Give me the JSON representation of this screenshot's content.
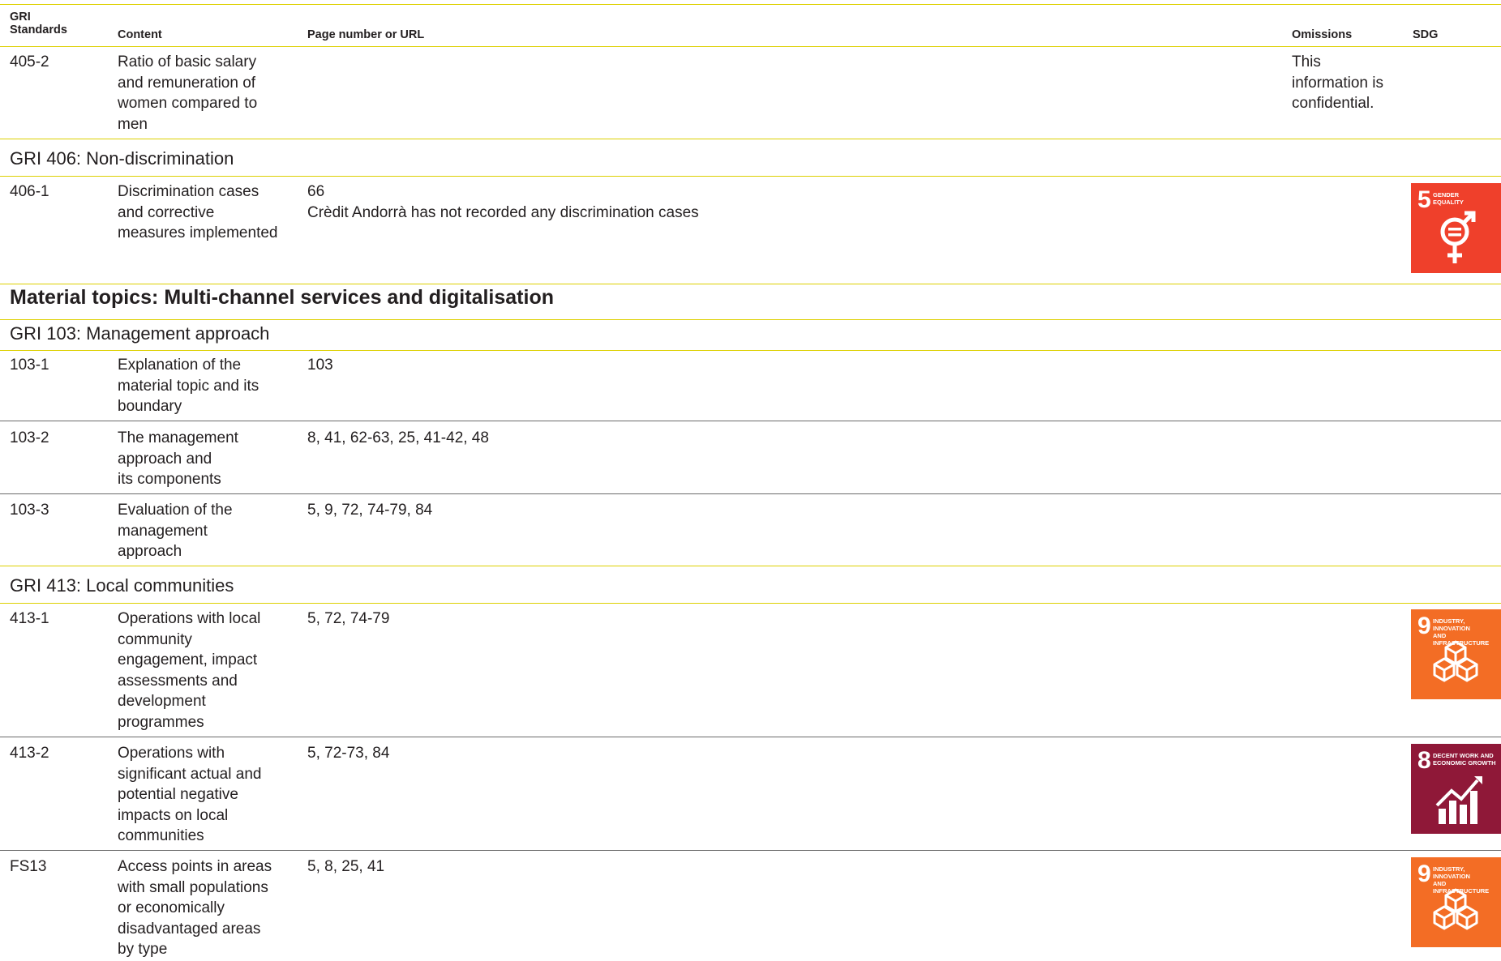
{
  "header": {
    "col_standards": "GRI\nStandards",
    "col_content": "Content",
    "col_page": "Page number or URL",
    "col_omissions": "Omissions",
    "col_sdg": "SDG"
  },
  "rows": [
    {
      "code": "405-2",
      "content": "Ratio of basic salary\nand remuneration of\nwomen compared to\nmen",
      "page": "",
      "omission": "This\ninformation is\nconfidential."
    },
    {
      "code": "406-1",
      "content": "Discrimination cases\nand corrective\nmeasures implemented",
      "page": "66\nCrèdit Andorrà has not recorded any discrimination cases"
    },
    {
      "code": "103-1",
      "content": "Explanation of the\nmaterial topic and its\nboundary",
      "page": "103"
    },
    {
      "code": "103-2",
      "content": "The management\napproach and\nits components",
      "page": "8, 41, 62-63, 25, 41-42, 48"
    },
    {
      "code": "103-3",
      "content": "Evaluation of the\nmanagement\napproach",
      "page": "5, 9, 72, 74-79, 84"
    },
    {
      "code": "413-1",
      "content": "Operations with local\ncommunity\nengagement, impact\nassessments and\ndevelopment\nprogrammes",
      "page": "5, 72, 74-79"
    },
    {
      "code": "413-2",
      "content": "Operations with\nsignificant actual and\npotential negative\nimpacts on local\ncommunities",
      "page": "5, 72-73, 84"
    },
    {
      "code": "FS13",
      "content": "Access points in areas\nwith small populations\nor economically\ndisadvantaged areas\nby type",
      "page": "5, 8, 25, 41"
    }
  ],
  "sections": {
    "gri406": "GRI 406: Non-discrimination",
    "material": "Material topics: Multi-channel services and digitalisation",
    "gri103": "GRI 103: Management approach",
    "gri413": "GRI 413: Local communities"
  },
  "sdg_badges": [
    {
      "number": "5",
      "title": "GENDER\nEQUALITY",
      "color": "#ef402b",
      "icon": "gender-equality-icon"
    },
    {
      "number": "9",
      "title": "INDUSTRY, INNOVATION\nAND INFRASTRUCTURE",
      "color": "#f36d25",
      "icon": "cubes-icon"
    },
    {
      "number": "8",
      "title": "DECENT WORK AND\nECONOMIC GROWTH",
      "color": "#8f1838",
      "icon": "growth-chart-icon"
    },
    {
      "number": "9",
      "title": "INDUSTRY, INNOVATION\nAND INFRASTRUCTURE",
      "color": "#f36d25",
      "icon": "cubes-icon"
    }
  ]
}
